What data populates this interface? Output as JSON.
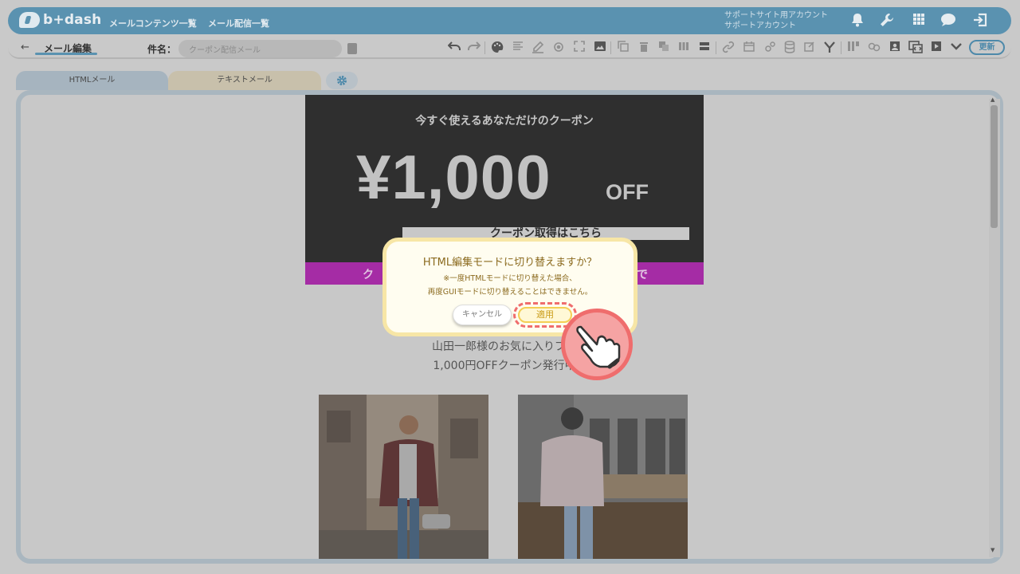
{
  "header": {
    "logo_text": "b+dash",
    "nav": [
      "メールコンテンツ一覧",
      "メール配信一覧"
    ],
    "account_line1": "サポートサイト用アカウント",
    "account_line2": "サポートアカウント",
    "icons": [
      "bell-icon",
      "wrench-icon",
      "grid-icon",
      "chat-icon",
      "logout-icon"
    ]
  },
  "toolbar": {
    "back_label": "←",
    "page_title": "メール編集",
    "subject_label": "件名：",
    "subject_value": "クーポン配信メール",
    "update_label": "更新",
    "icons": [
      "undo-icon",
      "redo-icon",
      "palette-icon",
      "align-icon",
      "pen-icon",
      "target-icon",
      "expand-icon",
      "image-icon",
      "copy-icon",
      "trash-icon",
      "duplicate-icon",
      "columns-icon",
      "rows-icon",
      "link-icon",
      "calendar-icon",
      "gears-icon",
      "database-icon",
      "edit-icon",
      "branch-icon",
      "blocks-icon",
      "chain-icon",
      "profile-icon",
      "code-icon",
      "play-icon",
      "chevron-down-icon"
    ]
  },
  "tabs": {
    "html": "HTMLメール",
    "text": "テキストメール"
  },
  "email": {
    "headline": "今すぐ使えるあなただけのクーポン",
    "price": "¥1,000",
    "price_suffix": "OFF",
    "coupon_button": "クーポン取得はこちら",
    "banner_left": "ク",
    "banner_right": "で",
    "line1": "山田一郎様のお気に入りブラ",
    "line2": "1,000円OFFクーポン発行中"
  },
  "dialog": {
    "title": "HTML編集モードに切り替えますか？",
    "note1": "※一度HTMLモードに切り替えた場合、",
    "note2": "再度GUIモードに切り替えることはできません。",
    "cancel": "キャンセル",
    "apply": "適用"
  },
  "colors": {
    "topbar": "#5a92b0",
    "purple_banner": "#a52ca5",
    "highlight": "#ef6d6d"
  }
}
